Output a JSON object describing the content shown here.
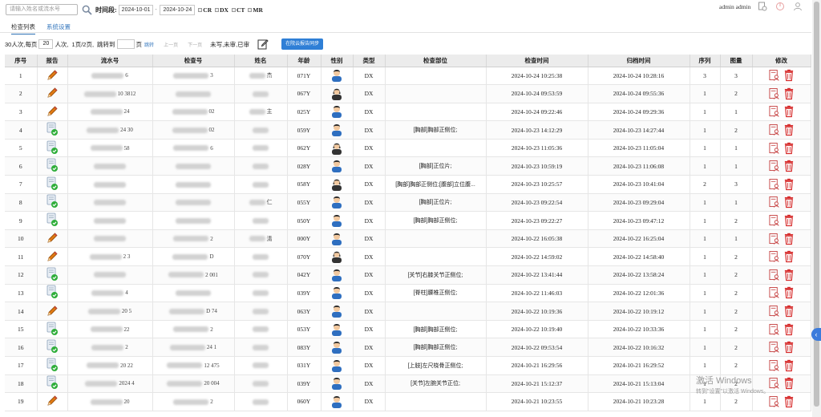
{
  "toolbar": {
    "search_placeholder": "请输入姓名或流水号",
    "time_label": "时间段:",
    "date_from": "2024-10-01",
    "date_to": "2024-10-24",
    "modalities": [
      "CR",
      "DX",
      "CT",
      "MR"
    ]
  },
  "user": {
    "name": "admin admin"
  },
  "tabs": [
    {
      "label": "检查列表"
    },
    {
      "label": "系统设置"
    }
  ],
  "pager": {
    "summary": "30人次,",
    "per_page_label": "每页",
    "per_page": "20",
    "per_page_unit": "人次,",
    "page_info": "1页/2页,",
    "jump_label": "跳转到",
    "jump_value": "",
    "page_unit": "页",
    "jump_btn": "跳转",
    "prev": "上一页",
    "next": "下一页",
    "status_unwritten": "未写",
    "status_unreviewed": "未审",
    "status_reviewed": "已审",
    "sync_btn": "在院云报告同步"
  },
  "columns": [
    "序号",
    "报告",
    "流水号",
    "检查号",
    "姓名",
    "年龄",
    "性别",
    "类型",
    "检查部位",
    "检查时间",
    "归档时间",
    "序列",
    "图量",
    "修改"
  ],
  "rows": [
    {
      "no": "1",
      "report": "pencil",
      "serial": "6",
      "exam": "3",
      "name": "杰",
      "age": "071Y",
      "gender": "male",
      "type": "DX",
      "part": "",
      "exam_time": "2024-10-24 10:25:38",
      "archive_time": "2024-10-24 10:28:16",
      "seq": "3",
      "imgs": "3"
    },
    {
      "no": "2",
      "report": "pencil",
      "serial": "10 3812",
      "exam": "",
      "name": "",
      "age": "067Y",
      "gender": "female",
      "type": "DX",
      "part": "",
      "exam_time": "2024-10-24 09:53:59",
      "archive_time": "2024-10-24 09:55:36",
      "seq": "1",
      "imgs": "2"
    },
    {
      "no": "3",
      "report": "pencil",
      "serial": "24",
      "exam": "02",
      "name": "主",
      "age": "025Y",
      "gender": "male",
      "type": "DX",
      "part": "",
      "exam_time": "2024-10-24 09:22:46",
      "archive_time": "2024-10-24 09:29:36",
      "seq": "1",
      "imgs": "1"
    },
    {
      "no": "4",
      "report": "done",
      "serial": "24 30",
      "exam": "02",
      "name": "",
      "age": "059Y",
      "gender": "male",
      "type": "DX",
      "part": "[胸部]胸部正侧位;",
      "exam_time": "2024-10-23 14:12:29",
      "archive_time": "2024-10-23 14:27:44",
      "seq": "1",
      "imgs": "2"
    },
    {
      "no": "5",
      "report": "done",
      "serial": "58",
      "exam": "6",
      "name": "",
      "age": "062Y",
      "gender": "female",
      "type": "DX",
      "part": "",
      "exam_time": "2024-10-23 11:05:36",
      "archive_time": "2024-10-23 11:05:04",
      "seq": "1",
      "imgs": "1"
    },
    {
      "no": "6",
      "report": "done",
      "serial": "",
      "exam": "",
      "name": "",
      "age": "028Y",
      "gender": "male",
      "type": "DX",
      "part": "[胸部]正位片;",
      "exam_time": "2024-10-23 10:59:19",
      "archive_time": "2024-10-23 11:06:08",
      "seq": "1",
      "imgs": "1"
    },
    {
      "no": "7",
      "report": "done",
      "serial": "",
      "exam": "",
      "name": "",
      "age": "058Y",
      "gender": "female",
      "type": "DX",
      "part": "[胸部]胸部正侧位;[腹部]立位腹...",
      "exam_time": "2024-10-23 10:25:57",
      "archive_time": "2024-10-23 10:41:04",
      "seq": "2",
      "imgs": "3"
    },
    {
      "no": "8",
      "report": "done",
      "serial": "",
      "exam": "",
      "name": "仁",
      "age": "055Y",
      "gender": "male",
      "type": "DX",
      "part": "[胸部]正位片;",
      "exam_time": "2024-10-23 09:22:54",
      "archive_time": "2024-10-23 09:29:04",
      "seq": "1",
      "imgs": "1"
    },
    {
      "no": "9",
      "report": "done",
      "serial": "",
      "exam": "",
      "name": "",
      "age": "050Y",
      "gender": "male",
      "type": "DX",
      "part": "[胸部]胸部正侧位;",
      "exam_time": "2024-10-23 09:22:27",
      "archive_time": "2024-10-23 09:47:12",
      "seq": "1",
      "imgs": "2"
    },
    {
      "no": "10",
      "report": "pencil",
      "serial": "",
      "exam": "2",
      "name": "清",
      "age": "000Y",
      "gender": "male",
      "type": "DX",
      "part": "",
      "exam_time": "2024-10-22 16:05:38",
      "archive_time": "2024-10-22 16:25:04",
      "seq": "1",
      "imgs": "1"
    },
    {
      "no": "11",
      "report": "pencil",
      "serial": "2 3",
      "exam": "D",
      "name": "",
      "age": "070Y",
      "gender": "female",
      "type": "DX",
      "part": "",
      "exam_time": "2024-10-22 14:59:02",
      "archive_time": "2024-10-22 14:58:40",
      "seq": "1",
      "imgs": "2"
    },
    {
      "no": "12",
      "report": "done",
      "serial": "",
      "exam": "2 001",
      "name": "",
      "age": "042Y",
      "gender": "male",
      "type": "DX",
      "part": "[关节]右膝关节正侧位;",
      "exam_time": "2024-10-22 13:41:44",
      "archive_time": "2024-10-22 13:58:24",
      "seq": "1",
      "imgs": "2"
    },
    {
      "no": "13",
      "report": "done",
      "serial": "4",
      "exam": "",
      "name": "",
      "age": "039Y",
      "gender": "male",
      "type": "DX",
      "part": "[脊柱]腰椎正侧位;",
      "exam_time": "2024-10-22 11:46:03",
      "archive_time": "2024-10-22 12:01:36",
      "seq": "1",
      "imgs": "2"
    },
    {
      "no": "14",
      "report": "pencil",
      "serial": "20 5",
      "exam": "D 74",
      "name": "",
      "age": "063Y",
      "gender": "male",
      "type": "DX",
      "part": "",
      "exam_time": "2024-10-22 10:19:36",
      "archive_time": "2024-10-22 10:19:12",
      "seq": "1",
      "imgs": "2"
    },
    {
      "no": "15",
      "report": "done",
      "serial": "22",
      "exam": "2",
      "name": "",
      "age": "053Y",
      "gender": "male",
      "type": "DX",
      "part": "[胸部]胸部正侧位;",
      "exam_time": "2024-10-22 10:19:40",
      "archive_time": "2024-10-22 10:33:36",
      "seq": "1",
      "imgs": "2"
    },
    {
      "no": "16",
      "report": "done",
      "serial": "2",
      "exam": "24 1",
      "name": "",
      "age": "083Y",
      "gender": "male",
      "type": "DX",
      "part": "[胸部]胸部正侧位;",
      "exam_time": "2024-10-22 09:53:54",
      "archive_time": "2024-10-22 10:16:32",
      "seq": "1",
      "imgs": "2"
    },
    {
      "no": "17",
      "report": "done",
      "serial": "20 22",
      "exam": "12 475",
      "name": "",
      "age": "031Y",
      "gender": "male",
      "type": "DX",
      "part": "[上肢]左尺桡骨正侧位;",
      "exam_time": "2024-10-21 16:29:56",
      "archive_time": "2024-10-21 16:29:52",
      "seq": "1",
      "imgs": "2"
    },
    {
      "no": "18",
      "report": "done",
      "serial": "2024 4",
      "exam": "20 004",
      "name": "",
      "age": "039Y",
      "gender": "male",
      "type": "DX",
      "part": "[关节]左腕关节正位;",
      "exam_time": "2024-10-21 15:12:37",
      "archive_time": "2024-10-21 15:13:04",
      "seq": "1",
      "imgs": "2"
    },
    {
      "no": "19",
      "report": "pencil",
      "serial": "20",
      "exam": "2",
      "name": "",
      "age": "060Y",
      "gender": "male",
      "type": "DX",
      "part": "",
      "exam_time": "2024-10-21 10:23:55",
      "archive_time": "2024-10-21 10:23:28",
      "seq": "1",
      "imgs": "2"
    }
  ],
  "watermark": {
    "title": "激活 Windows",
    "subtitle": "转到\"设置\"以激活 Windows。"
  },
  "colors": {
    "accent": "#2f7fd6",
    "delete": "#d62b2b",
    "pencil": "#e07a14",
    "check": "#2fae3a"
  }
}
